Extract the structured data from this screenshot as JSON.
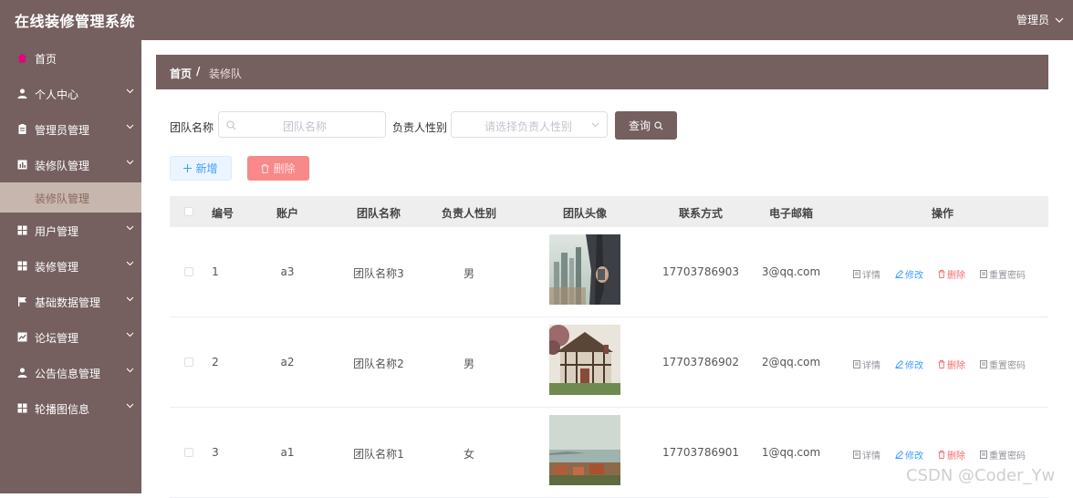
{
  "app": {
    "title": "在线装修管理系统",
    "user_label": "管理员"
  },
  "sidebar": {
    "items": [
      {
        "label": "首页",
        "icon": "home-icon",
        "has_arrow": false
      },
      {
        "label": "个人中心",
        "icon": "user-icon",
        "has_arrow": true
      },
      {
        "label": "管理员管理",
        "icon": "clipboard-icon",
        "has_arrow": true
      },
      {
        "label": "装修队管理",
        "icon": "chart-icon",
        "has_arrow": true
      },
      {
        "label": "用户管理",
        "icon": "grid-icon",
        "has_arrow": true
      },
      {
        "label": "装修管理",
        "icon": "grid-icon",
        "has_arrow": true
      },
      {
        "label": "基础数据管理",
        "icon": "flag-icon",
        "has_arrow": true
      },
      {
        "label": "论坛管理",
        "icon": "trend-icon",
        "has_arrow": true
      },
      {
        "label": "公告信息管理",
        "icon": "user-icon",
        "has_arrow": true
      },
      {
        "label": "轮播图信息",
        "icon": "grid-icon",
        "has_arrow": true
      }
    ],
    "active_sub": "装修队管理"
  },
  "breadcrumb": {
    "home": "首页",
    "separator": "/",
    "current": "装修队"
  },
  "search": {
    "name_label": "团队名称",
    "name_placeholder": "团队名称",
    "gender_label": "负责人性别",
    "gender_placeholder": "请选择负责人性别",
    "query_label": "查询"
  },
  "actions": {
    "add_label": "新增",
    "delete_label": "删除"
  },
  "table": {
    "columns": [
      "编号",
      "账户",
      "团队名称",
      "负责人性别",
      "团队头像",
      "联系方式",
      "电子邮箱",
      "操作"
    ],
    "rows": [
      {
        "id": "1",
        "account": "a3",
        "team": "团队名称3",
        "gender": "男",
        "image": "city-skyline-photo",
        "phone": "17703786903",
        "email": "3@qq.com"
      },
      {
        "id": "2",
        "account": "a2",
        "team": "团队名称2",
        "gender": "男",
        "image": "tudor-house-photo",
        "phone": "17703786902",
        "email": "2@qq.com"
      },
      {
        "id": "3",
        "account": "a1",
        "team": "团队名称1",
        "gender": "女",
        "image": "seaside-town-photo",
        "phone": "17703786901",
        "email": "1@qq.com"
      }
    ],
    "row_actions": {
      "detail": "详情",
      "edit": "修改",
      "delete": "删除",
      "reset": "重置密码"
    }
  },
  "watermark": "CSDN @Coder_Yw",
  "colors": {
    "primary": "#755f5f",
    "active_sub_bg": "#c7b6ae",
    "header_bg": "#eeeeef",
    "danger": "#f56c6c",
    "link": "#409eff"
  }
}
